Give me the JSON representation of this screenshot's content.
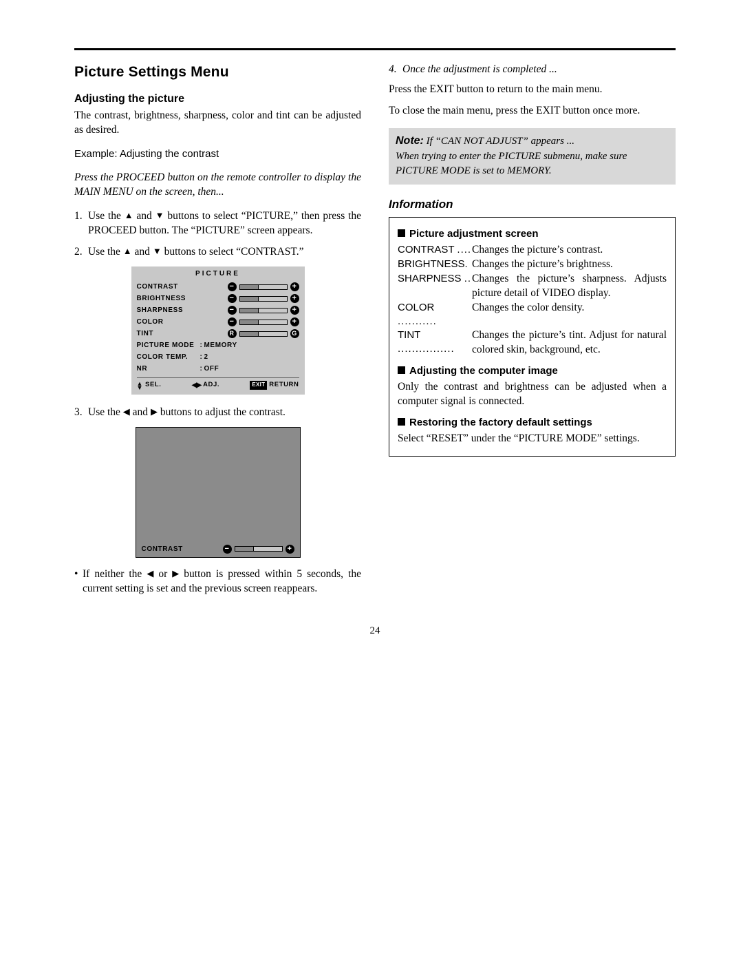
{
  "title": "Picture Settings Menu",
  "left": {
    "subheading": "Adjusting the picture",
    "intro": "The contrast, brightness, sharpness, color and tint can be adjusted as desired.",
    "example": "Example: Adjusting the contrast",
    "preamble": "Press the PROCEED button on the remote controller to display the MAIN MENU on the screen, then...",
    "step1_a": "Use the ",
    "step1_b": " and ",
    "step1_c": " buttons to select “PICTURE,” then press the PROCEED button. The “PICTURE” screen appears.",
    "step2_a": "Use the ",
    "step2_b": " and ",
    "step2_c": " buttons to select “CONTRAST.”",
    "step3_a": "Use the ",
    "step3_b": " and ",
    "step3_c": " buttons to adjust the contrast.",
    "bullet_a": "If neither the ",
    "bullet_b": " or ",
    "bullet_c": " button is pressed within 5 seconds, the current setting is set and the previous screen reappears."
  },
  "osd": {
    "title": "PICTURE",
    "rows": {
      "contrast": "CONTRAST",
      "brightness": "BRIGHTNESS",
      "sharpness": "SHARPNESS",
      "color": "COLOR",
      "tint": "TINT",
      "picture_mode": "PICTURE MODE",
      "picture_mode_val": "MEMORY",
      "color_temp": "COLOR TEMP.",
      "color_temp_val": "2",
      "nr": "NR",
      "nr_val": "OFF"
    },
    "foot": {
      "sel": "SEL.",
      "adj": "ADJ.",
      "ret": "RETURN",
      "exit": "EXIT"
    }
  },
  "preview": {
    "label": "CONTRAST"
  },
  "right": {
    "step4": "Once the adjustment is completed ...",
    "p1": "Press the EXIT button to return to the main menu.",
    "p2": "To close the main menu, press the EXIT button once more.",
    "note_label": "Note:",
    "note_lead": " If “CAN NOT ADJUST” appears ...",
    "note_body": "When trying to enter the PICTURE submenu, make sure PICTURE MODE is set to MEMORY.",
    "info_title": "Information",
    "info_sub1": "Picture adjustment screen",
    "defs": {
      "contrast_t": "CONTRAST",
      "contrast_d": "Changes the picture’s contrast.",
      "brightness_t": "BRIGHTNESS",
      "brightness_d": "Changes the picture’s brightness.",
      "sharpness_t": "SHARPNESS",
      "sharpness_d": "Changes the picture’s sharpness. Adjusts picture detail of VIDEO display.",
      "color_t": "COLOR",
      "color_d": "Changes the color density.",
      "tint_t": "TINT",
      "tint_d": "Changes the picture’s tint. Adjust for natural colored skin, background, etc."
    },
    "info_sub2": "Adjusting the computer image",
    "info_p2": "Only the contrast and brightness can be adjusted when a computer signal is connected.",
    "info_sub3": "Restoring the factory default settings",
    "info_p3": "Select “RESET” under the “PICTURE MODE” settings."
  },
  "page": "24"
}
